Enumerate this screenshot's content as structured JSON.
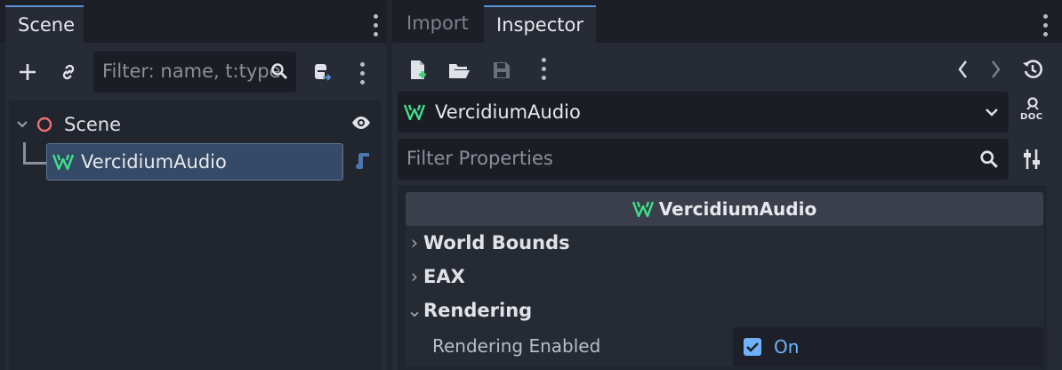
{
  "scene_panel": {
    "tab_label": "Scene",
    "filter_placeholder": "Filter: name, t:type",
    "tree": {
      "root_label": "Scene",
      "child_label": "VercidiumAudio"
    }
  },
  "inspector_panel": {
    "tabs": [
      {
        "label": "Import"
      },
      {
        "label": "Inspector"
      }
    ],
    "object_name": "VercidiumAudio",
    "doc_label": "DOC",
    "filter_placeholder": "Filter Properties",
    "class_header": "VercidiumAudio",
    "sections": [
      {
        "label": "World Bounds",
        "expanded": false
      },
      {
        "label": "EAX",
        "expanded": false
      },
      {
        "label": "Rendering",
        "expanded": true
      }
    ],
    "property": {
      "label": "Rendering Enabled",
      "value_label": "On",
      "checked": true
    }
  },
  "colors": {
    "accent": "#5b8fd6",
    "vercidium_green": "#3fe08a",
    "selected_row": "#354a66",
    "value_text": "#6fb3ff"
  }
}
